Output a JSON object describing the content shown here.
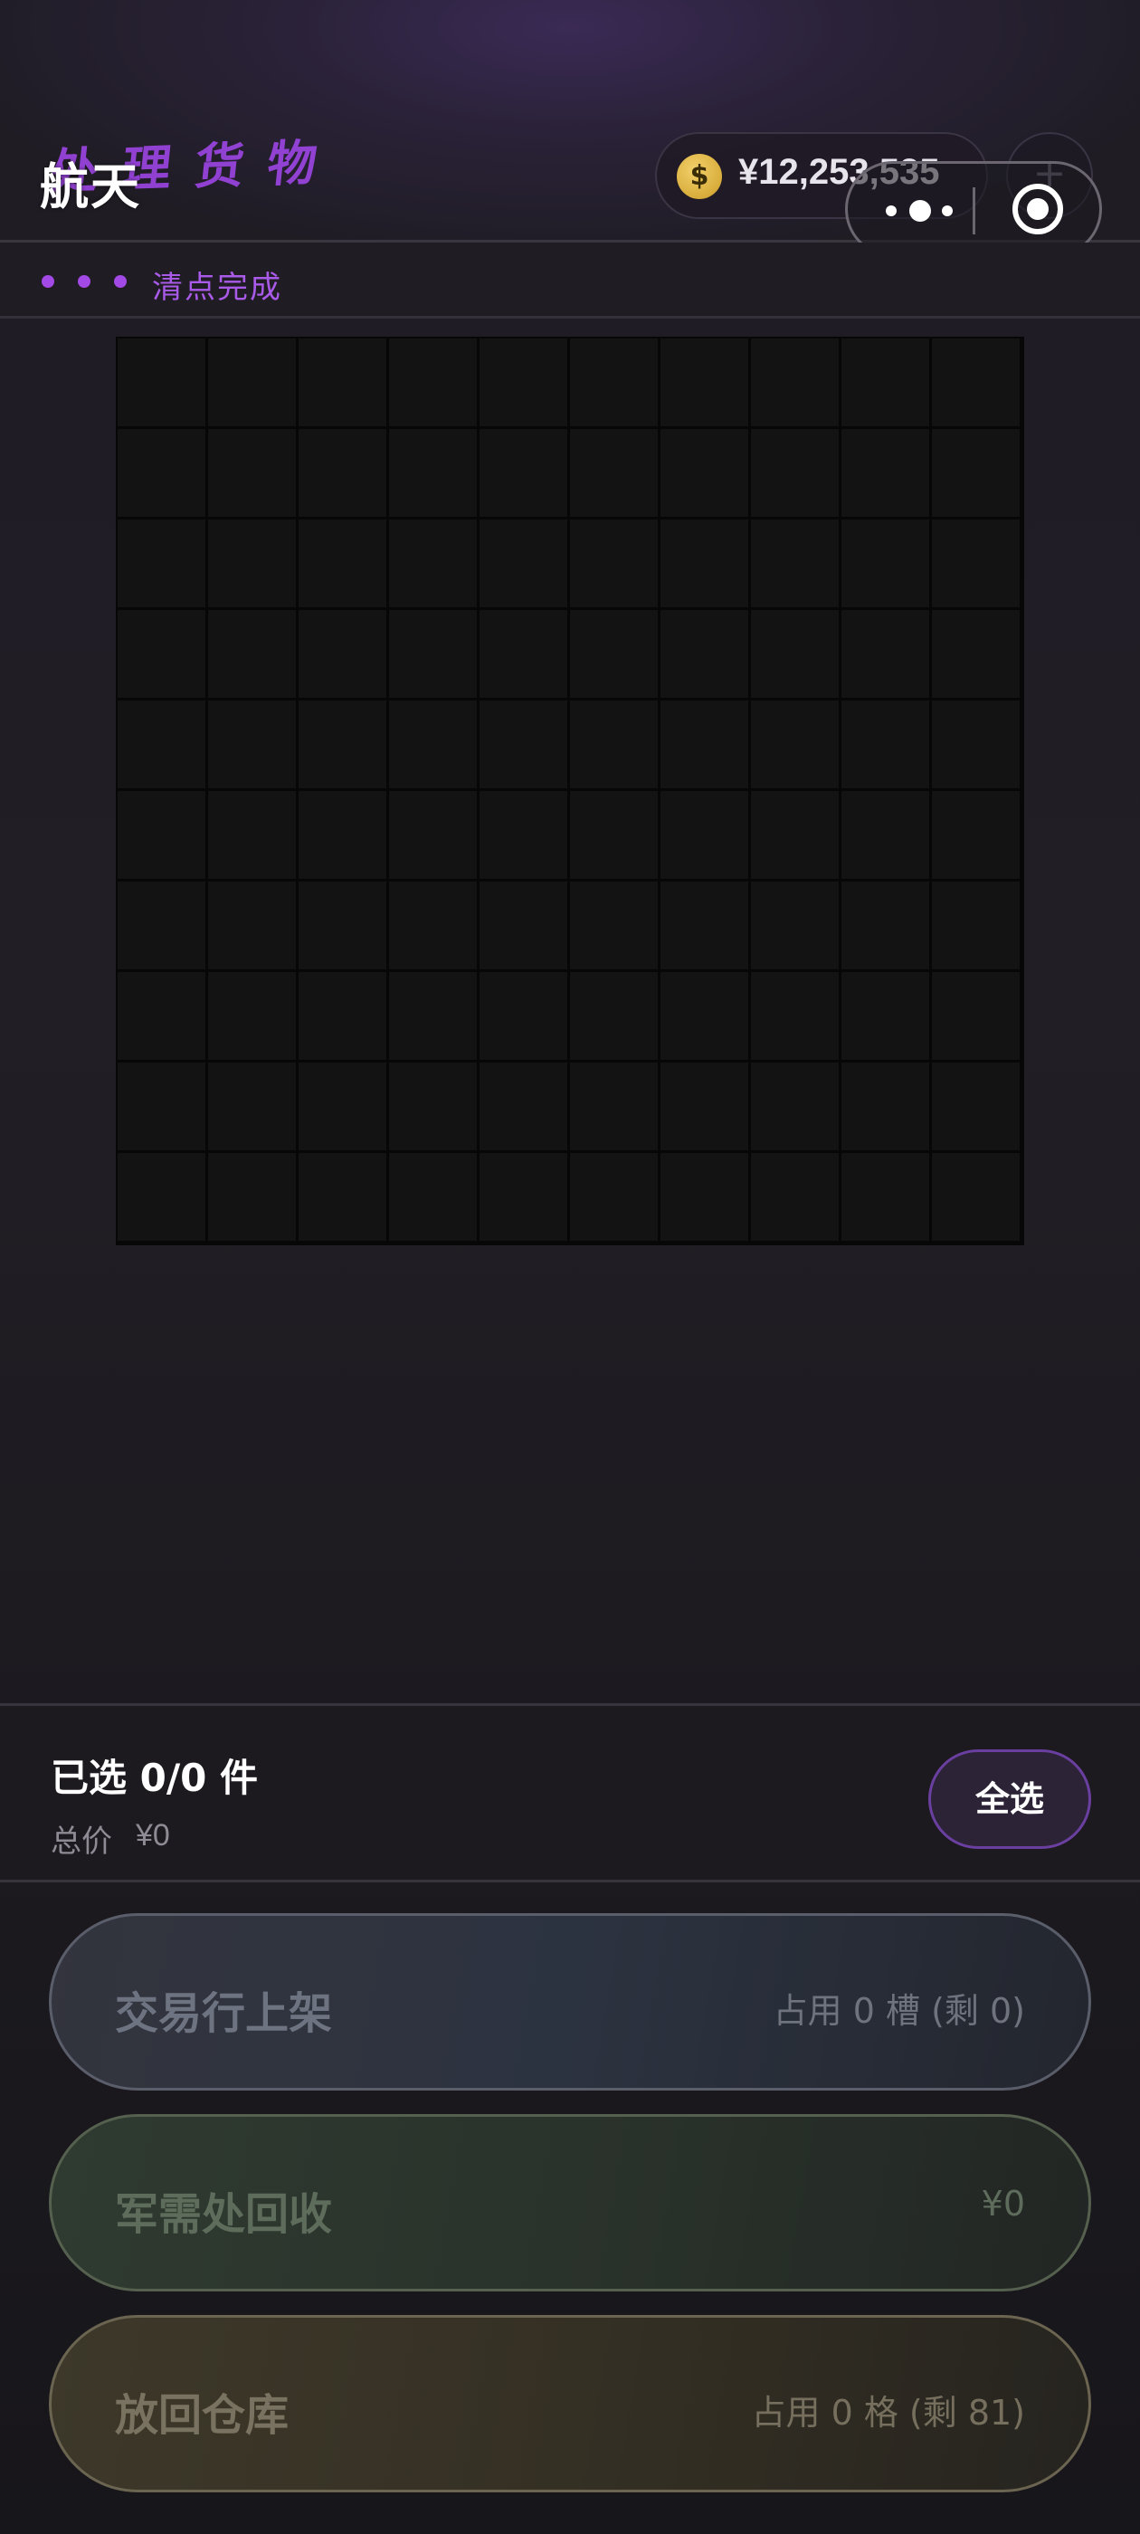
{
  "header": {
    "title_ghost": "处理货物",
    "title": "航天",
    "currency_icon": "dollar-coin-icon",
    "currency_symbol": "$",
    "balance": "¥12,253,535",
    "add_label": "+"
  },
  "status": {
    "text": "清点完成"
  },
  "grid": {
    "rows": 10,
    "cols": 10
  },
  "selection": {
    "title": "已选 0/0 件",
    "total_label": "总价",
    "total_value": "¥0",
    "select_all_label": "全选"
  },
  "actions": [
    {
      "label": "交易行上架",
      "info": "占用 0 槽 (剩 0)"
    },
    {
      "label": "军需处回收",
      "info": "¥0"
    },
    {
      "label": "放回仓库",
      "info": "占用 0 格 (剩 81)"
    }
  ],
  "colors": {
    "accent_purple": "#a349e6",
    "coin_gold": "#d8ad3c"
  }
}
